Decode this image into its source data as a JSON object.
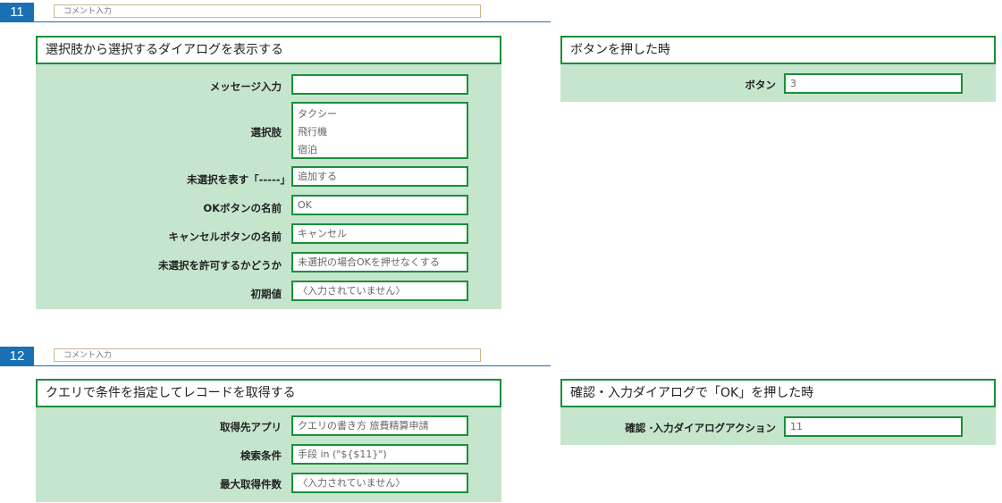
{
  "rows": [
    {
      "number": "11",
      "comment_placeholder": "コメント入力",
      "left_panel": {
        "title": "選択肢から選択するダイアログを表示する",
        "fields": {
          "message": {
            "label": "メッセージ入力",
            "value": ""
          },
          "options": {
            "label": "選択肢",
            "values": [
              "タクシー",
              "飛行機",
              "宿泊"
            ]
          },
          "unselected": {
            "label": "未選択を表す「-----」",
            "value": "追加する"
          },
          "ok_name": {
            "label": "OKボタンの名前",
            "value": "OK"
          },
          "cancel_name": {
            "label": "キャンセルボタンの名前",
            "value": "キャンセル"
          },
          "allow_unselected": {
            "label": "未選択を許可するかどうか",
            "value": "未選択の場合OKを押せなくする"
          },
          "initial": {
            "label": "初期値",
            "value": "〈入力されていません〉"
          }
        }
      },
      "right_panel": {
        "title": "ボタンを押した時",
        "fields": {
          "button": {
            "label": "ボタン",
            "value": "3"
          }
        }
      }
    },
    {
      "number": "12",
      "comment_placeholder": "コメント入力",
      "left_panel": {
        "title": "クエリで条件を指定してレコードを取得する",
        "fields": {
          "source_app": {
            "label": "取得先アプリ",
            "value": "クエリの書き方 旅費精算申請"
          },
          "search_condition": {
            "label": "検索条件",
            "value": "手段 in (\"${$11}\")"
          },
          "max_count": {
            "label": "最大取得件数",
            "value": "〈入力されていません〉"
          }
        }
      },
      "right_panel": {
        "title": "確認・入力ダイアログで「OK」を押した時",
        "fields": {
          "action": {
            "label": "確認 ·入力ダイアログアクション",
            "value": "11"
          }
        }
      }
    }
  ],
  "colors": {
    "accent_blue": "#1a6fb5",
    "panel_green_border": "#1a8f3a",
    "panel_green_bg": "#c5e6cc"
  }
}
